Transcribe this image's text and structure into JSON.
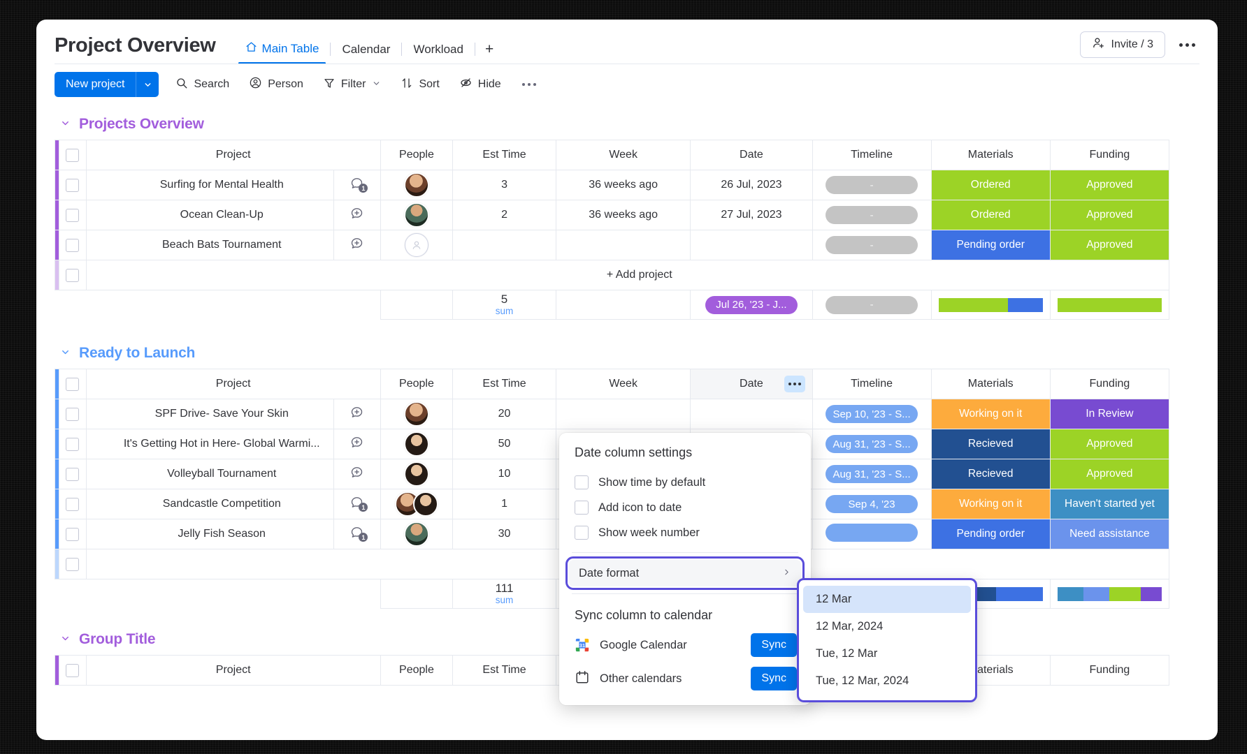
{
  "header": {
    "board_title": "Project Overview",
    "tabs": [
      {
        "label": "Main Table",
        "icon": "home-icon",
        "active": true
      },
      {
        "label": "Calendar",
        "active": false
      },
      {
        "label": "Workload",
        "active": false
      }
    ],
    "add_tab_label": "+",
    "invite_label": "Invite / 3",
    "invite_icon": "person-add-icon",
    "more_icon": "ellipsis-icon"
  },
  "toolbar": {
    "new_project_label": "New project",
    "new_project_caret": "chevron-down-icon",
    "buttons": [
      {
        "label": "Search",
        "icon": "search-icon"
      },
      {
        "label": "Person",
        "icon": "person-circle-icon"
      },
      {
        "label": "Filter",
        "icon": "funnel-icon",
        "caret": true
      },
      {
        "label": "Sort",
        "icon": "sort-arrows-icon"
      },
      {
        "label": "Hide",
        "icon": "eye-off-icon"
      }
    ],
    "more_icon": "ellipsis-icon"
  },
  "columns": [
    "Project",
    "People",
    "Est Time",
    "Week",
    "Date",
    "Timeline",
    "Materials",
    "Funding"
  ],
  "add_project_label": "+ Add project",
  "sum_label": "sum",
  "groups": [
    {
      "title": "Projects Overview",
      "color": "#a25ddc",
      "chevron": "chevron-down-icon",
      "rows": [
        {
          "project": "Surfing for Mental Health",
          "chat": {
            "icon": "comment-icon",
            "count": "1"
          },
          "people": [
            "avatar-woman-1"
          ],
          "est_time": "3",
          "week": "36 weeks ago",
          "date": "26 Jul, 2023",
          "timeline": "-",
          "timeline_style": "gray",
          "materials": {
            "label": "Ordered",
            "color": "#9cd326"
          },
          "funding": {
            "label": "Approved",
            "color": "#9cd326"
          }
        },
        {
          "project": "Ocean Clean-Up",
          "chat": {
            "icon": "comment-add-icon",
            "count": ""
          },
          "people": [
            "avatar-woman-2"
          ],
          "est_time": "2",
          "week": "36 weeks ago",
          "date": "27 Jul, 2023",
          "timeline": "-",
          "timeline_style": "gray",
          "materials": {
            "label": "Ordered",
            "color": "#9cd326"
          },
          "funding": {
            "label": "Approved",
            "color": "#9cd326"
          }
        },
        {
          "project": "Beach Bats Tournament",
          "chat": {
            "icon": "comment-add-icon",
            "count": ""
          },
          "people": [
            "avatar-empty"
          ],
          "est_time": "",
          "week": "",
          "date": "",
          "timeline": "-",
          "timeline_style": "gray",
          "materials": {
            "label": "Pending order",
            "color": "#3d71e3"
          },
          "funding": {
            "label": "Approved",
            "color": "#9cd326"
          }
        }
      ],
      "summary": {
        "est_time": "5",
        "date_pill": "Jul 26, '23 - J...",
        "date_pill_style": "purple",
        "timeline": "-",
        "timeline_style": "gray",
        "materials_bars": [
          {
            "color": "#9cd326",
            "pct": 66.6
          },
          {
            "color": "#3d71e3",
            "pct": 33.4
          }
        ],
        "funding_bars": [
          {
            "color": "#9cd326",
            "pct": 100
          }
        ]
      }
    },
    {
      "title": "Ready to Launch",
      "color": "#579bfc",
      "chevron": "chevron-down-icon",
      "rows": [
        {
          "project": "SPF Drive- Save Your Skin",
          "chat": {
            "icon": "comment-add-icon",
            "count": ""
          },
          "people": [
            "avatar-woman-1"
          ],
          "est_time": "20",
          "week": "",
          "date": "",
          "timeline": "Sep 10, '23 - S...",
          "timeline_style": "blue",
          "materials": {
            "label": "Working on it",
            "color": "#fdab3d"
          },
          "funding": {
            "label": "In Review",
            "color": "#784bd1"
          }
        },
        {
          "project": "It's Getting Hot in Here- Global Warmi...",
          "chat": {
            "icon": "comment-add-icon",
            "count": ""
          },
          "people": [
            "avatar-woman-3"
          ],
          "est_time": "50",
          "week": "",
          "date": "",
          "timeline": "Aug 31, '23 - S...",
          "timeline_style": "blue",
          "materials": {
            "label": "Recieved",
            "color": "#225091"
          },
          "funding": {
            "label": "Approved",
            "color": "#9cd326"
          }
        },
        {
          "project": "Volleyball Tournament",
          "chat": {
            "icon": "comment-add-icon",
            "count": ""
          },
          "people": [
            "avatar-woman-3"
          ],
          "est_time": "10",
          "week": "",
          "date": "",
          "timeline": "Aug 31, '23 - S...",
          "timeline_style": "blue",
          "materials": {
            "label": "Recieved",
            "color": "#225091"
          },
          "funding": {
            "label": "Approved",
            "color": "#9cd326"
          }
        },
        {
          "project": "Sandcastle Competition",
          "chat": {
            "icon": "comment-icon",
            "count": "1"
          },
          "people": [
            "avatar-woman-1",
            "avatar-woman-3"
          ],
          "est_time": "1",
          "week": "",
          "date": "",
          "timeline": "Sep 4, '23",
          "timeline_style": "blue",
          "materials": {
            "label": "Working on it",
            "color": "#fdab3d"
          },
          "funding": {
            "label": "Haven't started yet",
            "color": "#3d8fc4"
          }
        },
        {
          "project": "Jelly Fish Season",
          "chat": {
            "icon": "comment-icon",
            "count": "1"
          },
          "people": [
            "avatar-woman-2"
          ],
          "est_time": "30",
          "week": "",
          "date": "",
          "timeline": "",
          "timeline_style": "blue",
          "materials": {
            "label": "Pending order",
            "color": "#3d71e3"
          },
          "funding": {
            "label": "Need assistance",
            "color": "#6b93ec"
          }
        }
      ],
      "summary": {
        "est_time": "111",
        "date_pill": "",
        "timeline": "",
        "materials_bars": [
          {
            "color": "#225091",
            "pct": 55
          },
          {
            "color": "#3d71e3",
            "pct": 45
          }
        ],
        "funding_bars": [
          {
            "color": "#3d8fc4",
            "pct": 25
          },
          {
            "color": "#6b93ec",
            "pct": 25
          },
          {
            "color": "#9cd326",
            "pct": 30
          },
          {
            "color": "#784bd1",
            "pct": 20
          }
        ]
      }
    },
    {
      "title": "Group Title",
      "color": "#a25ddc",
      "chevron": "chevron-down-icon",
      "rows": [],
      "summary": null
    }
  ],
  "popup": {
    "title": "Date column settings",
    "checkboxes": [
      {
        "label": "Show time by default",
        "checked": false
      },
      {
        "label": "Add icon to date",
        "checked": false
      },
      {
        "label": "Show week number",
        "checked": false
      }
    ],
    "date_format_label": "Date format",
    "date_format_chevron": "chevron-right-icon",
    "sync_title": "Sync column to calendar",
    "sync_rows": [
      {
        "label": "Google Calendar",
        "icon": "google-calendar-icon",
        "button": "Sync"
      },
      {
        "label": "Other calendars",
        "icon": "calendar-icon",
        "button": "Sync"
      }
    ]
  },
  "submenu": {
    "items": [
      {
        "label": "12 Mar",
        "selected": true
      },
      {
        "label": "12 Mar, 2024",
        "selected": false
      },
      {
        "label": "Tue, 12 Mar",
        "selected": false
      },
      {
        "label": "Tue, 12 Mar, 2024",
        "selected": false
      }
    ]
  },
  "colors": {
    "accent_blue": "#0073ea",
    "highlight_purple": "#5a4ddb",
    "group_purple": "#a25ddc",
    "group_blue": "#579bfc"
  }
}
